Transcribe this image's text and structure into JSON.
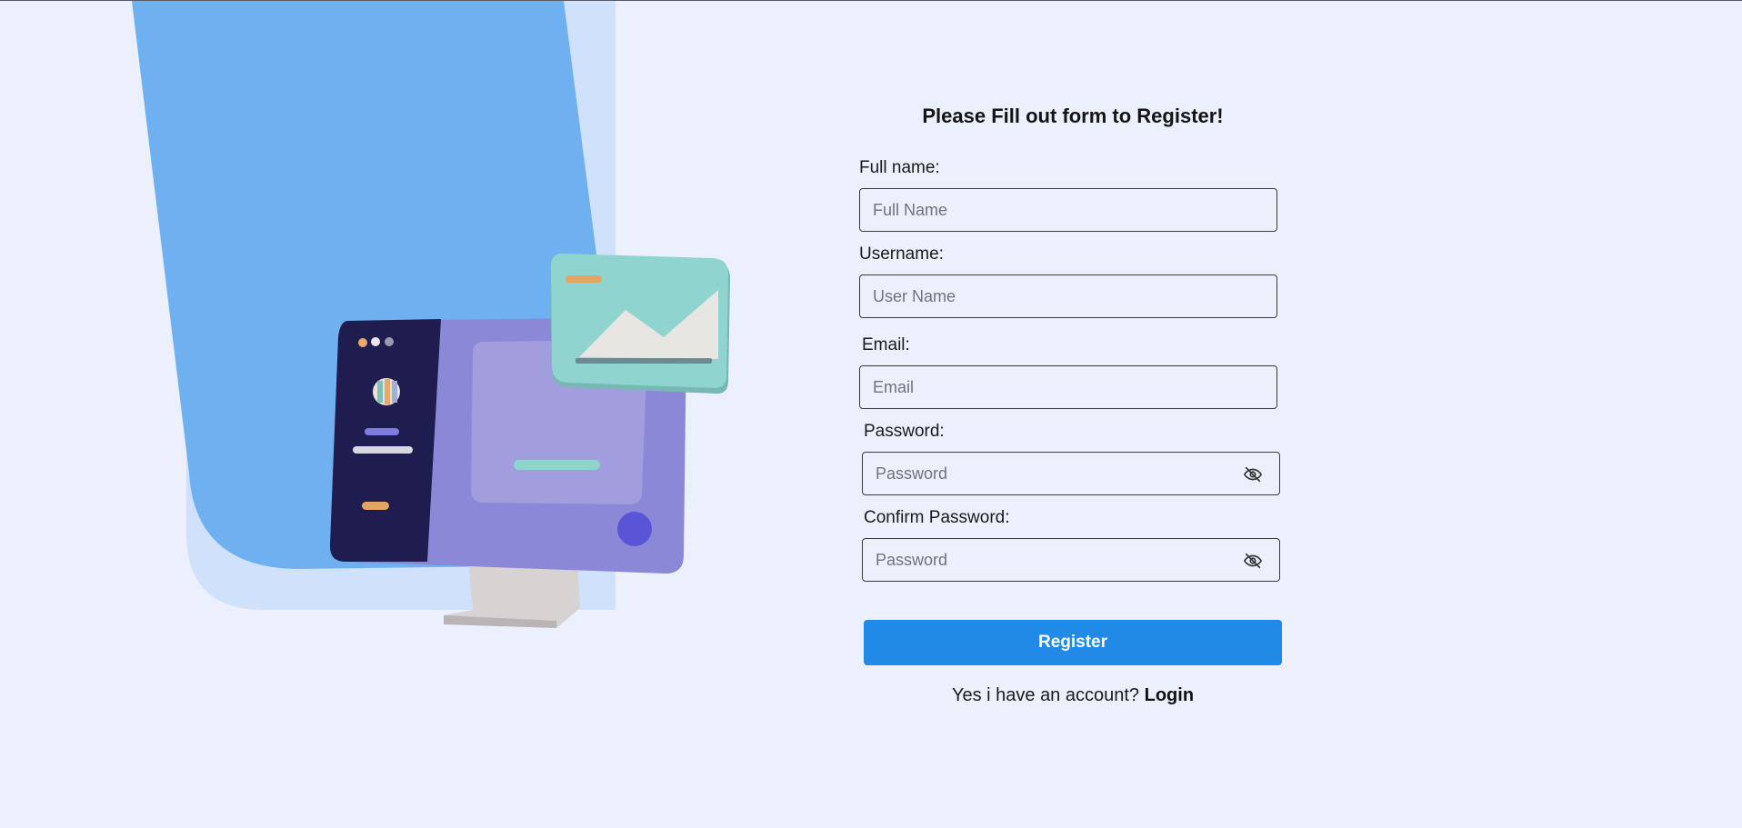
{
  "form": {
    "title": "Please Fill out form to Register!",
    "fields": [
      {
        "label": "Full name:",
        "placeholder": "Full Name",
        "value": ""
      },
      {
        "label": "Username:",
        "placeholder": "User Name",
        "value": ""
      },
      {
        "label": "Email:",
        "placeholder": "Email",
        "value": ""
      },
      {
        "label": "Password:",
        "placeholder": "Password",
        "value": "",
        "toggle_icon": "eye-slash-icon"
      },
      {
        "label": "Confirm Password:",
        "placeholder": "Password",
        "value": "",
        "toggle_icon": "eye-slash-icon"
      }
    ],
    "submit_label": "Register",
    "login_prompt": "Yes i have an account?",
    "login_link": "Login"
  },
  "illustration": {
    "subject": "computer-monitor-illustration"
  },
  "colors": {
    "background": "#ecf0fd",
    "accent": "#2189e6",
    "panel_blue": "#6eb0f0",
    "panel_blue_light": "#cfe1fb",
    "monitor_dark": "#1f1d4f",
    "monitor_screen": "#8b88d8",
    "card_teal": "#8fd4cf"
  }
}
